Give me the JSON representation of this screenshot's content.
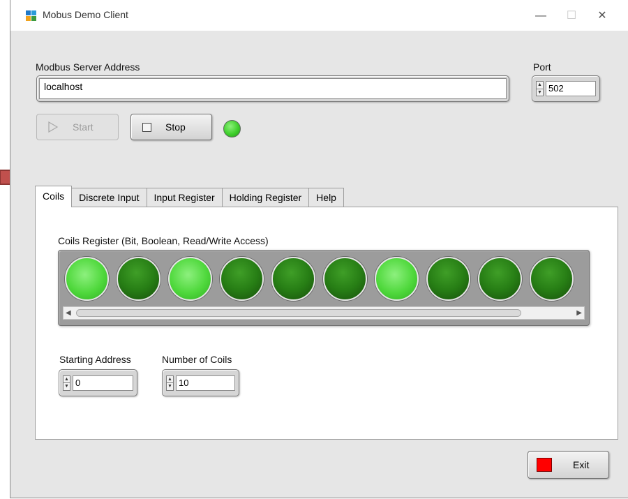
{
  "window": {
    "title": "Mobus Demo Client",
    "minimize": "—",
    "maximize": "☐",
    "close": "✕"
  },
  "server": {
    "address_label": "Modbus Server Address",
    "address_value": "localhost"
  },
  "port": {
    "label": "Port",
    "value": "502"
  },
  "buttons": {
    "start": "Start",
    "stop": "Stop",
    "exit": "Exit"
  },
  "status_led": {
    "state": "on",
    "color": "#3fcf2c"
  },
  "tabs": [
    "Coils",
    "Discrete Input",
    "Input Register",
    "Holding Register",
    "Help"
  ],
  "active_tab": "Coils",
  "coils": {
    "caption": "Coils Register (Bit, Boolean, Read/Write Access)",
    "values": [
      true,
      false,
      true,
      false,
      false,
      false,
      true,
      false,
      false,
      false
    ],
    "on_color": "#4fd83c",
    "off_color": "#277e15"
  },
  "starting_address": {
    "label": "Starting Address",
    "value": "0"
  },
  "number_of_coils": {
    "label": "Number of Coils",
    "value": "10"
  },
  "icons": {
    "app": "app-icon",
    "start": "play-icon",
    "stop": "stop-icon",
    "exit": "red-square-icon",
    "arrow": "right-arrow-icon"
  }
}
